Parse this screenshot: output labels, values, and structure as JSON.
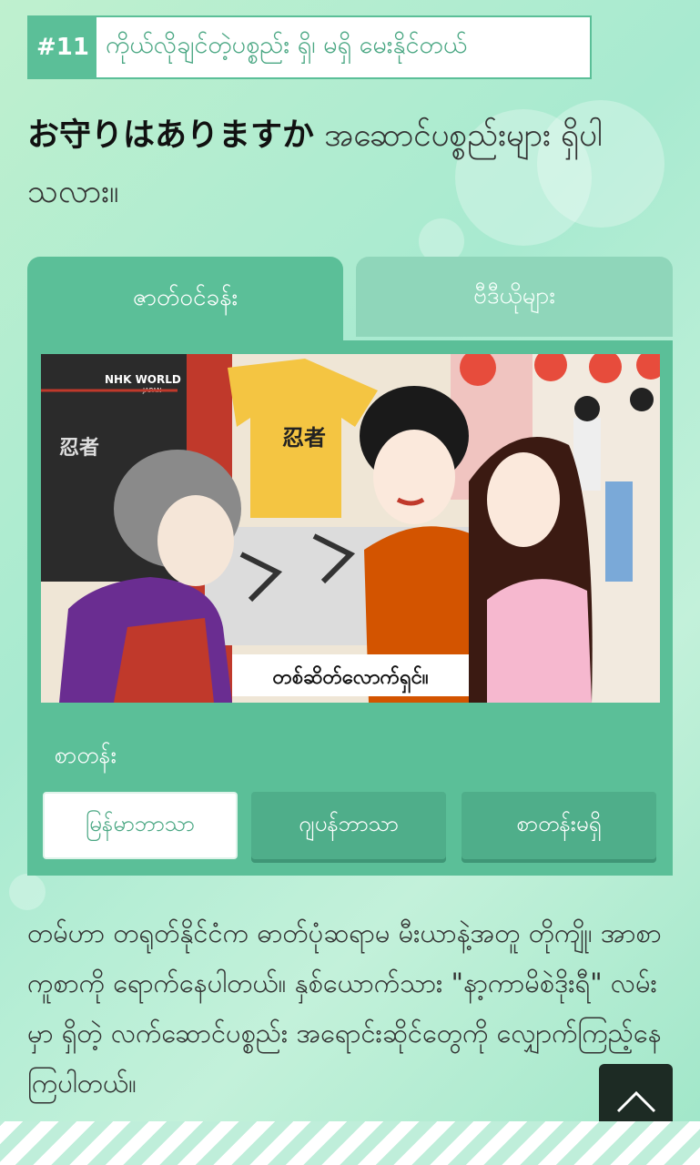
{
  "lesson": {
    "number": "#11",
    "title": "ကိုယ်လိုချင်တဲ့ပစ္စည်း ရှိ၊ မရှိ မေးနိုင်တယ်"
  },
  "phrase": {
    "japanese": "お守りはありますか",
    "myanmar": " အဆောင်ပစ္စည်းများ ရှိပါသလား။"
  },
  "tabs": [
    {
      "label": "ဇာတ်ဝင်ခန်း",
      "active": true
    },
    {
      "label": "ဗီဒီယိုများ",
      "active": false
    }
  ],
  "video": {
    "logo": "NHK WORLD",
    "logo_sub": "JAPAN",
    "shirt_text": "忍者",
    "subtitle": "တစ်ဆိတ်လောက်ရှင်။"
  },
  "subtitles": {
    "label": "စာတန်း",
    "options": [
      "မြန်မာဘာသာ",
      "ဂျပန်ဘာသာ",
      "စာတန်းမရှိ"
    ],
    "selected": "မြန်မာဘာသာ"
  },
  "description": "တမ်ဟာ တရုတ်နိုင်ငံက ဓာတ်ပုံဆရာမ မီးယာနဲ့အတူ တိုကျို၊ အာစာကူစာကို ရောက်နေပါတယ်။ နှစ်ယောက်သား \"နာ့ကာမိစဲဒိုးရီ\" လမ်းမှာ ရှိတဲ့ လက်ဆောင်ပစ္စည်း အရောင်းဆိုင်တွေကို လျှောက်ကြည့်နေကြပါတယ်။",
  "colors": {
    "accent": "#5bbf98",
    "accent_dark": "#4fae8a",
    "title_text": "#4aa783"
  }
}
